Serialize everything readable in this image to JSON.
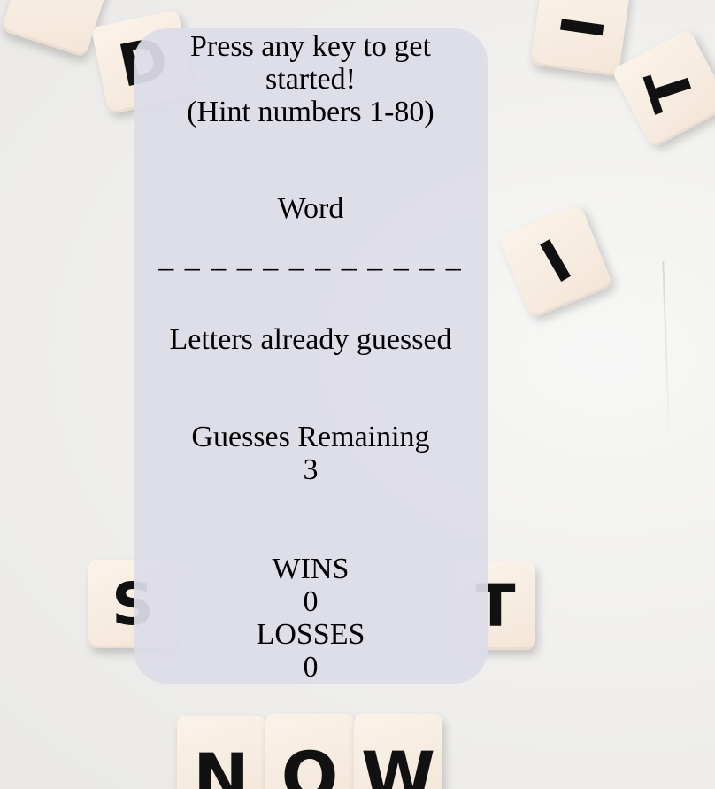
{
  "intro": {
    "line1": "Press any key to get",
    "line2": "started!",
    "line3": "(Hint numbers 1-80)"
  },
  "word": {
    "label": "Word",
    "display": "_ _ _ _ _ _ _ _ _ _ _ _"
  },
  "guessed": {
    "label": "Letters already guessed",
    "value": ""
  },
  "remaining": {
    "label": "Guesses Remaining",
    "value": "3"
  },
  "score": {
    "wins_label": "WINS",
    "wins": "0",
    "losses_label": "LOSSES",
    "losses": "0"
  },
  "background": {
    "tiles": [
      "D",
      "I",
      "T",
      "I",
      "S",
      "T",
      "N",
      "O",
      "W"
    ]
  },
  "colors": {
    "panel": "#ddddE8",
    "text": "#000000",
    "background": "#f2f1f0",
    "tile": "#f6ebdf"
  }
}
